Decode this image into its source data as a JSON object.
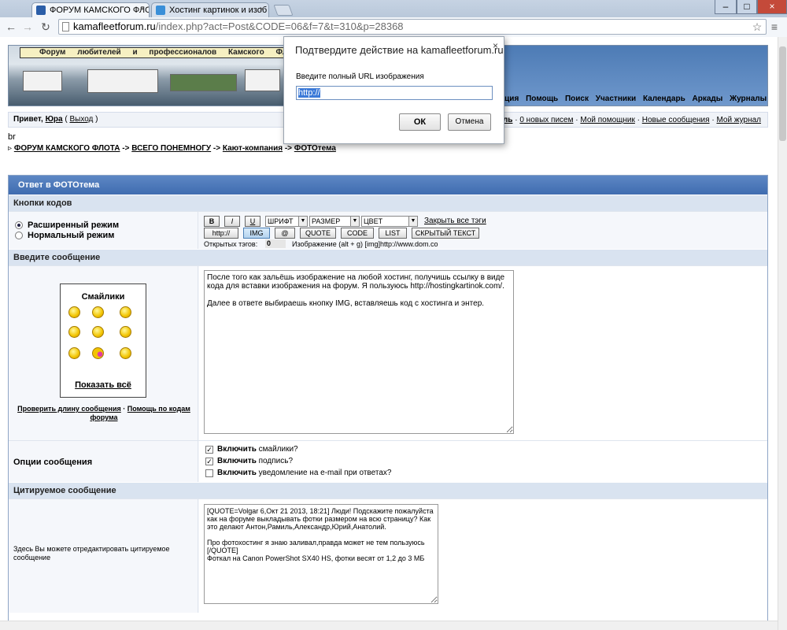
{
  "browser": {
    "tabs": [
      {
        "title": "ФОРУМ КАМСКОГО ФЛО",
        "favicon": "forum-favicon"
      },
      {
        "title": "Хостинг картинок и изоб",
        "favicon": "hosting-favicon"
      }
    ],
    "url_host": "kamafleetforum.ru",
    "url_path": "/index.php?act=Post&CODE=06&f=7&t=310&p=28368",
    "window_buttons": [
      "–",
      "□",
      "×"
    ]
  },
  "banner": {
    "title": "Форум любителей и профессионалов Камского Флота"
  },
  "nav": [
    "утация",
    "Помощь",
    "Поиск",
    "Участники",
    "Календарь",
    "Аркады",
    "Журналы"
  ],
  "userbar": {
    "greeting": "Привет,",
    "username": "Юра",
    "logout": "Выход",
    "right_links": [
      "филь",
      "0 новых писем",
      "Мой помощник",
      "Новые сообщения",
      "Мой журнал"
    ]
  },
  "br_text": "br",
  "breadcrumb": [
    "ФОРУМ КАМСКОГО ФЛОТА",
    "ВСЕГО ПОНЕМНОГУ",
    "Кают-компания",
    "ФОТОтема"
  ],
  "breadcrumb_sep": "->",
  "form": {
    "title": "Ответ в ФОТОтема",
    "sections": {
      "codes": "Кнопки кодов",
      "message": "Введите сообщение",
      "quoted": "Цитируемое сообщение"
    },
    "modes": [
      "Расширенный режим",
      "Нормальный режим"
    ],
    "code_buttons_row1": [
      "B",
      "I",
      "U"
    ],
    "selects": [
      "ШРИФТ",
      "РАЗМЕР",
      "ЦВЕТ"
    ],
    "close_tags": "Закрыть все тэги",
    "code_buttons_row2": [
      "http://",
      "IMG",
      "@",
      "QUOTE",
      "CODE",
      "LIST",
      "СКРЫТЫЙ ТЕКСТ"
    ],
    "open_tags_label": "Открытых тэгов:",
    "open_tags_count": "0",
    "hint": "Изображение (alt + g) [img]http://www.dom.co",
    "smilies_title": "Смайлики",
    "show_all": "Показать всё",
    "check_length": "Проверить длину сообщения",
    "help_codes": "Помощь по кодам форума",
    "message_text": "После того как зальёшь изображение на любой хостинг, получишь ссылку в виде кода для вставки изображения на форум. Я пользуюсь http://hostingkartinok.com/.\n\nДалее в ответе выбираешь кнопку IMG, вставляешь код с хостинга и энтер.",
    "options_label": "Опции сообщения",
    "options": [
      {
        "bold": "Включить",
        "rest": " смайлики?",
        "checked": true
      },
      {
        "bold": "Включить",
        "rest": " подпись?",
        "checked": true
      },
      {
        "bold": "Включить",
        "rest": " уведомление на e-mail при ответах?",
        "checked": false
      }
    ],
    "quote_hint": "Здесь Вы можете отредактировать цитируемое сообщение",
    "quote_text": "[QUOTE=Volgar 6,Окт 21 2013, 18:21] Люди! Подскажите пожалуйста как на форуме выкладывать фотки размером на всю страницу? Как это делают Антон,Рамиль,Александр,Юрий,Анатолий.\n\nПро фотохостинг я знаю заливал,правда может не тем пользуюсь [/QUOTE]\nФоткал на Canon PowerShot SX40 HS, фотки весят от 1,2 до 3 МБ"
  },
  "dialog": {
    "title": "Подтвердите действие на kamafleetforum.ru",
    "close": "×",
    "label": "Введите полный URL изображения",
    "value": "http://",
    "ok": "ОК",
    "cancel": "Отмена"
  }
}
